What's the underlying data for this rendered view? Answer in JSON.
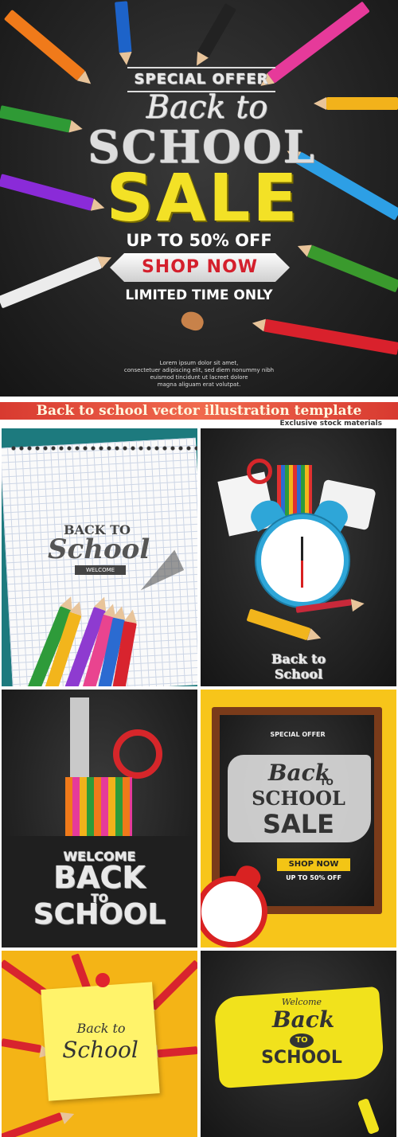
{
  "hero": {
    "badge": "SPECIAL OFFER",
    "title_line1": "Back to",
    "title_line2": "SCHOOL",
    "title_line3": "SALE",
    "discount": "UP TO 50% OFF",
    "cta": "SHOP NOW",
    "limited": "LIMITED TIME ONLY",
    "lorem": [
      "Lorem ipsum dolor sit amet,",
      "consectetuer adipiscing elit, sed diem nonummy nibh",
      "euismod tincidunt ut lacreet dolore",
      "magna aliguam erat volutpat."
    ]
  },
  "banner": {
    "title": "Back to school vector illustration template",
    "subtitle": "Exclusive stock materials",
    "bg_color": "#e8473b"
  },
  "tiles": {
    "t1": {
      "line1": "BACK TO",
      "line2": "School",
      "ribbon": "WELCOME"
    },
    "t2": {
      "label": "Back to School"
    },
    "t3": {
      "welcome": "WELCOME",
      "back": "BACK",
      "to": "TO",
      "school": "SCHOOL"
    },
    "t4": {
      "badge": "SPECIAL OFFER",
      "back": "Back",
      "to": "TO",
      "school": "SCHOOL",
      "sale": "SALE",
      "cta": "SHOP NOW",
      "discount": "UP TO 50% OFF"
    },
    "t5": {
      "back": "Back to",
      "school": "School"
    },
    "t6": {
      "welcome": "Welcome",
      "back": "Back",
      "to": "TO",
      "school": "SCHOOL"
    }
  }
}
